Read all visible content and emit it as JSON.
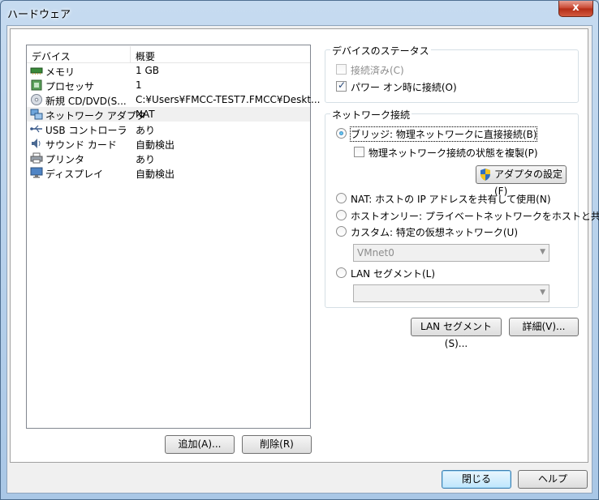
{
  "window": {
    "title": "ハードウェア",
    "close_glyph": "x"
  },
  "device_list": {
    "headers": [
      "デバイス",
      "概要"
    ],
    "rows": [
      {
        "name": "メモリ",
        "value": "1 GB",
        "icon": "memory-icon"
      },
      {
        "name": "プロセッサ",
        "value": "1",
        "icon": "processor-icon"
      },
      {
        "name": "新規 CD/DVD(S...",
        "value": "C:¥Users¥FMCC-TEST7.FMCC¥Deskt...",
        "icon": "cd-dvd-icon"
      },
      {
        "name": "ネットワーク アダプタ",
        "value": "NAT",
        "icon": "network-adapter-icon"
      },
      {
        "name": "USB コントローラ",
        "value": "あり",
        "icon": "usb-icon"
      },
      {
        "name": "サウンド カード",
        "value": "自動検出",
        "icon": "sound-icon"
      },
      {
        "name": "プリンタ",
        "value": "あり",
        "icon": "printer-icon"
      },
      {
        "name": "ディスプレイ",
        "value": "自動検出",
        "icon": "display-icon"
      }
    ],
    "add_label": "追加(A)...",
    "remove_label": "削除(R)"
  },
  "device_status": {
    "title": "デバイスのステータス",
    "connected_label": "接続済み(C)",
    "connect_on_power_label": "パワー オン時に接続(O)"
  },
  "network": {
    "title": "ネットワーク接続",
    "bridged_label": "ブリッジ: 物理ネットワークに直接接続(B)",
    "replicate_label": "物理ネットワーク接続の状態を複製(P)",
    "adapter_settings_label": "アダプタの設定(F)",
    "nat_label": "NAT: ホストの IP アドレスを共有して使用(N)",
    "hostonly_label": "ホストオンリー: プライベートネットワークをホストと共有(H)",
    "custom_label": "カスタム: 特定の仮想ネットワーク(U)",
    "custom_value": "VMnet0",
    "lan_segment_label": "LAN セグメント(L)",
    "lan_segment_value": ""
  },
  "buttons": {
    "lan_segments": "LAN セグメント(S)...",
    "advanced": "詳細(V)...",
    "close": "閉じる",
    "help": "ヘルプ"
  },
  "colors": {
    "accent": "#3c7fb1",
    "title_bg": "#b9d1ea",
    "close_red": "#c7422c"
  }
}
